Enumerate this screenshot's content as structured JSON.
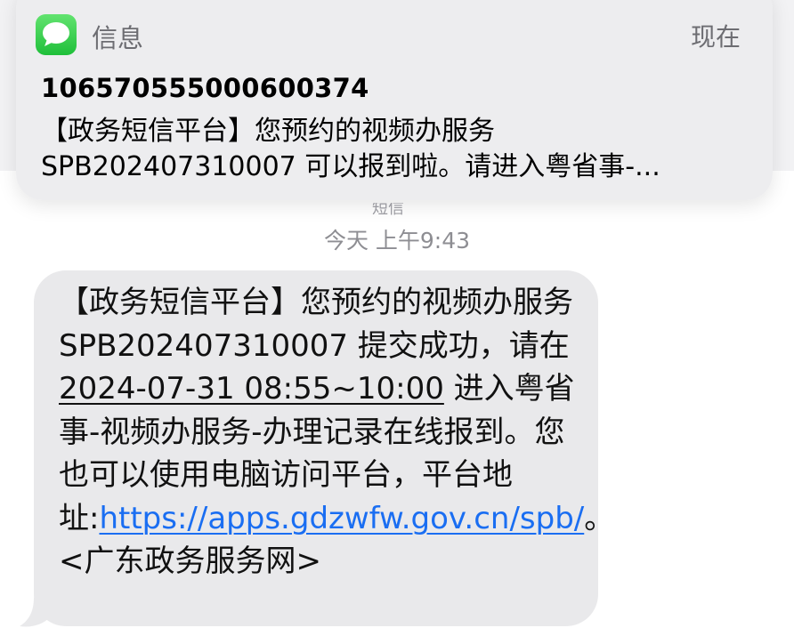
{
  "notification": {
    "app_name": "信息",
    "time": "现在",
    "sender": "10657055500060037‌4",
    "preview_line1": "【政务短信平台】您预约的视频办服务",
    "preview_line2": "SPB202407310007 可以报到啦。请进入粤省事-..."
  },
  "conversation": {
    "ghost_label": "短信",
    "timestamp": "今天 上午9:43",
    "message": {
      "part1": "【政务短信平台】您预约的视频办服务 SPB202407310007 提交成功，请在 ",
      "datetime": "2024-07-31 08:55~10:00",
      "part2": " 进入粤省事-视频办服务-办理记录在线报到。您也可以使用电脑访问平台，平台地址:",
      "link": "https://apps.gdzwfw.gov.cn/spb/",
      "part3": "。<广东政务服务网>"
    }
  },
  "colors": {
    "bubble": "#e9e9eb",
    "link": "#1a6ef2",
    "app_icon": "#34c759"
  },
  "icons": {
    "app": "message-bubble-icon"
  }
}
